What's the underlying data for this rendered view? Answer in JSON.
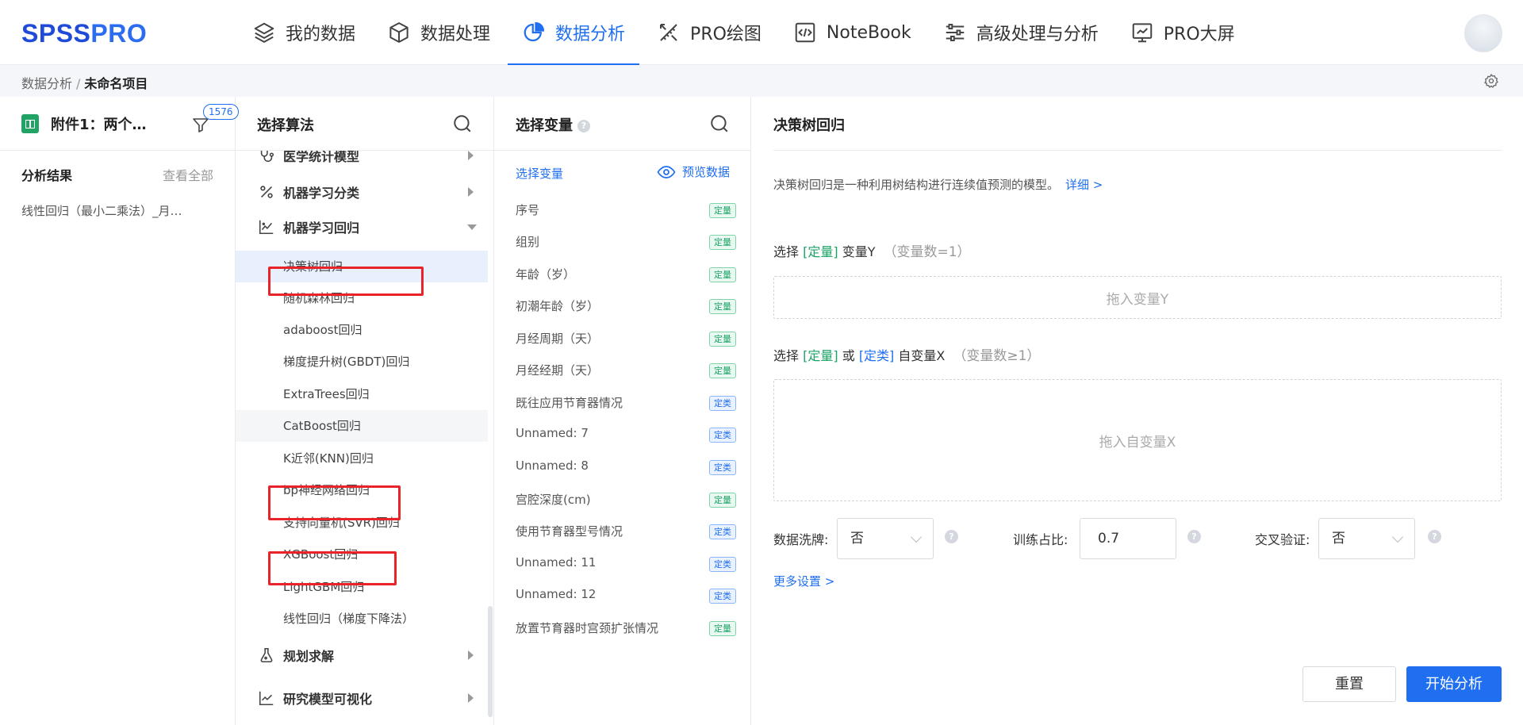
{
  "brand": {
    "part1": "SPSS",
    "part2": "PRO"
  },
  "nav": [
    {
      "label": "我的数据",
      "icon": "layers-icon",
      "active": false
    },
    {
      "label": "数据处理",
      "icon": "cube-icon",
      "active": false
    },
    {
      "label": "数据分析",
      "icon": "pie-chart-icon",
      "active": true
    },
    {
      "label": "PRO绘图",
      "icon": "brush-ruler-icon",
      "active": false
    },
    {
      "label": "NoteBook",
      "icon": "code-icon",
      "active": false
    },
    {
      "label": "高级处理与分析",
      "icon": "sliders-icon",
      "active": false
    },
    {
      "label": "PRO大屏",
      "icon": "dashboard-icon",
      "active": false
    }
  ],
  "breadcrumb": {
    "parent": "数据分析",
    "separator": "/",
    "current": "未命名项目"
  },
  "file_panel": {
    "file_name": "附件1：两个…",
    "filter_count": "1576",
    "results_title": "分析结果",
    "view_all": "查看全部",
    "result_item": "线性回归（最小二乘法）_月…"
  },
  "algo_panel": {
    "title": "选择算法",
    "categories": [
      {
        "label": "医学统计模型",
        "icon": "stethoscope-icon",
        "expanded": false
      },
      {
        "label": "机器学习分类",
        "icon": "percent-icon",
        "expanded": false
      },
      {
        "label": "机器学习回归",
        "icon": "line-chart-icon",
        "expanded": true
      },
      {
        "label": "规划求解",
        "icon": "flask-icon",
        "expanded": false
      },
      {
        "label": "研究模型可视化",
        "icon": "trend-chart-icon",
        "expanded": false
      }
    ],
    "regression_items": [
      "决策树回归",
      "随机森林回归",
      "adaboost回归",
      "梯度提升树(GBDT)回归",
      "ExtraTrees回归",
      "CatBoost回归",
      "K近邻(KNN)回归",
      "bp神经网络回归",
      "支持向量机(SVR)回归",
      "XGBoost回归",
      "LightGBM回归",
      "线性回归（梯度下降法）"
    ],
    "selected_index": 0,
    "hover_index": 5
  },
  "var_panel": {
    "title": "选择变量",
    "sub_title": "选择变量",
    "preview": "预览数据",
    "variables": [
      {
        "name": "序号",
        "type": "定量",
        "kind": "q"
      },
      {
        "name": "组别",
        "type": "定量",
        "kind": "q"
      },
      {
        "name": "年龄（岁）",
        "type": "定量",
        "kind": "q"
      },
      {
        "name": "初潮年龄（岁）",
        "type": "定量",
        "kind": "q"
      },
      {
        "name": "月经周期（天）",
        "type": "定量",
        "kind": "q"
      },
      {
        "name": "月经经期（天）",
        "type": "定量",
        "kind": "q"
      },
      {
        "name": "既往应用节育器情况",
        "type": "定类",
        "kind": "c"
      },
      {
        "name": "Unnamed: 7",
        "type": "定类",
        "kind": "c"
      },
      {
        "name": "Unnamed: 8",
        "type": "定类",
        "kind": "c"
      },
      {
        "name": "宫腔深度(cm)",
        "type": "定量",
        "kind": "q"
      },
      {
        "name": "使用节育器型号情况",
        "type": "定类",
        "kind": "c"
      },
      {
        "name": "Unnamed: 11",
        "type": "定类",
        "kind": "c"
      },
      {
        "name": "Unnamed: 12",
        "type": "定类",
        "kind": "c"
      },
      {
        "name": "放置节育器时宫颈扩张情况",
        "type": "定量",
        "kind": "q"
      }
    ]
  },
  "config": {
    "title": "决策树回归",
    "description": "决策树回归是一种利用树结构进行连续值预测的模型。",
    "detail_link": "详细 >",
    "y_label": {
      "pre": "选择",
      "tag": "[定量]",
      "post": "变量Y",
      "count": "（变量数=1）"
    },
    "y_drop": "拖入变量Y",
    "x_label": {
      "pre": "选择",
      "tag1": "[定量]",
      "or": "或",
      "tag2": "[定类]",
      "post": "自变量X",
      "count": "（变量数≥1）"
    },
    "x_drop": "拖入自变量X",
    "shuffle": {
      "label": "数据洗牌:",
      "value": "否"
    },
    "train_ratio": {
      "label": "训练占比:",
      "value": "0.7"
    },
    "cross_val": {
      "label": "交叉验证:",
      "value": "否"
    },
    "more_settings": "更多设置 >",
    "reset_btn": "重置",
    "start_btn": "开始分析"
  },
  "colors": {
    "accent": "#1f6ff0",
    "quant": "#1aa365",
    "highlight": "#e8232a"
  }
}
